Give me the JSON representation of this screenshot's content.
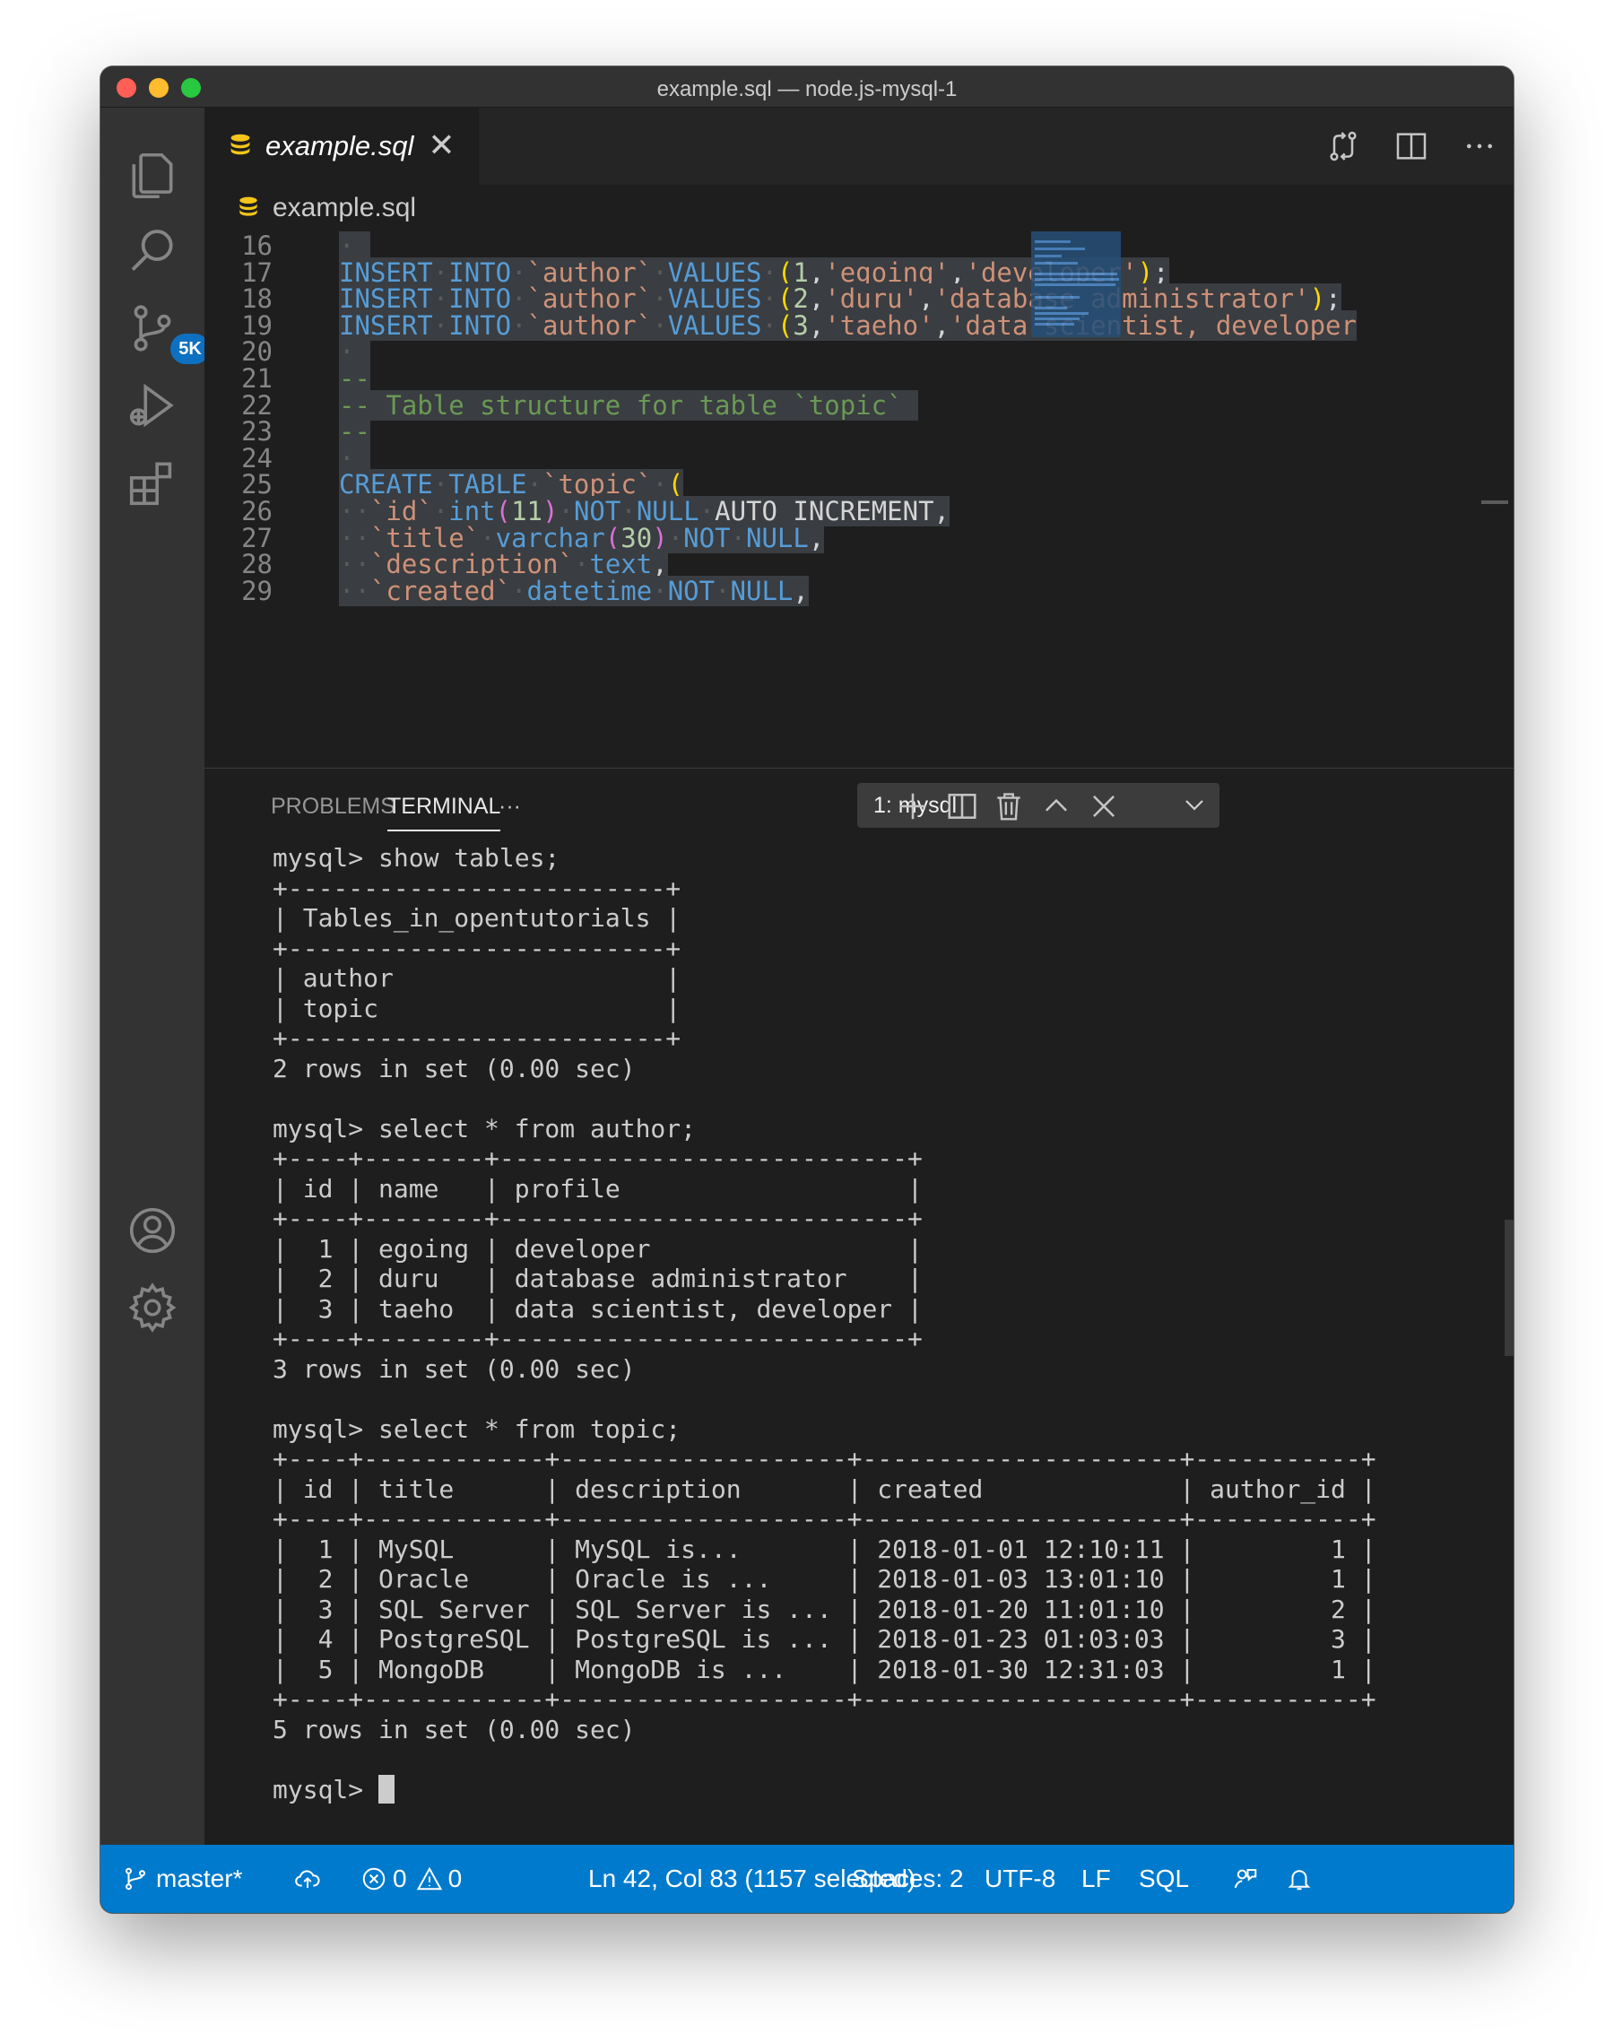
{
  "window": {
    "title": "example.sql — node.js-mysql-1"
  },
  "activity": {
    "badge": "5K"
  },
  "tab": {
    "name": "example.sql",
    "close": "✕"
  },
  "breadcrumb": {
    "file": "example.sql"
  },
  "editor": {
    "lines": [
      {
        "n": "16"
      },
      {
        "n": "17"
      },
      {
        "n": "18"
      },
      {
        "n": "19"
      },
      {
        "n": "20"
      },
      {
        "n": "21"
      },
      {
        "n": "22"
      },
      {
        "n": "23"
      },
      {
        "n": "24"
      },
      {
        "n": "25"
      },
      {
        "n": "26"
      },
      {
        "n": "27"
      },
      {
        "n": "28"
      },
      {
        "n": "29"
      }
    ],
    "code": {
      "l17": {
        "k1": "INSERT",
        "k2": "INTO",
        "tbl": "`author`",
        "k3": "VALUES",
        "p1": "(",
        "v1": "1",
        "v2": "'egoing'",
        "v3": "'developer'",
        "p2": ")",
        "end": ";"
      },
      "l18": {
        "k1": "INSERT",
        "k2": "INTO",
        "tbl": "`author`",
        "k3": "VALUES",
        "p1": "(",
        "v1": "2",
        "v2": "'duru'",
        "v3": "'database administrator'",
        "p2": ")",
        "end": ";"
      },
      "l19": {
        "k1": "INSERT",
        "k2": "INTO",
        "tbl": "`author`",
        "k3": "VALUES",
        "p1": "(",
        "v1": "3",
        "v2": "'taeho'",
        "v3": "'data scientist, developer"
      },
      "l21": "--",
      "l22": "-- Table structure for table `topic`",
      "l23": "--",
      "l25": {
        "k1": "CREATE",
        "k2": "TABLE",
        "tbl": "`topic`",
        "p1": "("
      },
      "l26": {
        "col": "`id`",
        "typ": "int",
        "p1": "(",
        "n": "11",
        "p2": ")",
        "k1": "NOT",
        "k2": "NULL",
        "extra": "AUTO_INCREMENT,"
      },
      "l27": {
        "col": "`title`",
        "typ": "varchar",
        "p1": "(",
        "n": "30",
        "p2": ")",
        "k1": "NOT",
        "k2": "NULL",
        "end": ","
      },
      "l28": {
        "col": "`description`",
        "typ": "text",
        "end": ","
      },
      "l29": {
        "col": "`created`",
        "typ": "datetime",
        "k1": "NOT",
        "k2": "NULL",
        "end": ","
      }
    }
  },
  "panel": {
    "tabs": {
      "problems": "PROBLEMS",
      "terminal": "TERMINAL",
      "more": "···"
    },
    "terminal_select": "1: mysql"
  },
  "terminal": {
    "lines": [
      "mysql> show tables;",
      "+-------------------------+",
      "| Tables_in_opentutorials |",
      "+-------------------------+",
      "| author                  |",
      "| topic                   |",
      "+-------------------------+",
      "2 rows in set (0.00 sec)",
      "",
      "mysql> select * from author;",
      "+----+--------+---------------------------+",
      "| id | name   | profile                   |",
      "+----+--------+---------------------------+",
      "|  1 | egoing | developer                 |",
      "|  2 | duru   | database administrator    |",
      "|  3 | taeho  | data scientist, developer |",
      "+----+--------+---------------------------+",
      "3 rows in set (0.00 sec)",
      "",
      "mysql> select * from topic;",
      "+----+------------+-------------------+---------------------+-----------+",
      "| id | title      | description       | created             | author_id |",
      "+----+------------+-------------------+---------------------+-----------+",
      "|  1 | MySQL      | MySQL is...       | 2018-01-01 12:10:11 |         1 |",
      "|  2 | Oracle     | Oracle is ...     | 2018-01-03 13:01:10 |         1 |",
      "|  3 | SQL Server | SQL Server is ... | 2018-01-20 11:01:10 |         2 |",
      "|  4 | PostgreSQL | PostgreSQL is ... | 2018-01-23 01:03:03 |         3 |",
      "|  5 | MongoDB    | MongoDB is ...    | 2018-01-30 12:31:03 |         1 |",
      "+----+------------+-------------------+---------------------+-----------+",
      "5 rows in set (0.00 sec)",
      ""
    ],
    "prompt": "mysql> "
  },
  "statusbar": {
    "branch": "master*",
    "errors": "0",
    "warnings": "0",
    "position": "Ln 42, Col 83 (1157 selected)",
    "spaces": "Spaces: 2",
    "encoding": "UTF-8",
    "eol": "LF",
    "language": "SQL"
  },
  "colors": {
    "accent": "#007acc",
    "badge": "#0e70c0",
    "db_icon": "#f5c518"
  }
}
